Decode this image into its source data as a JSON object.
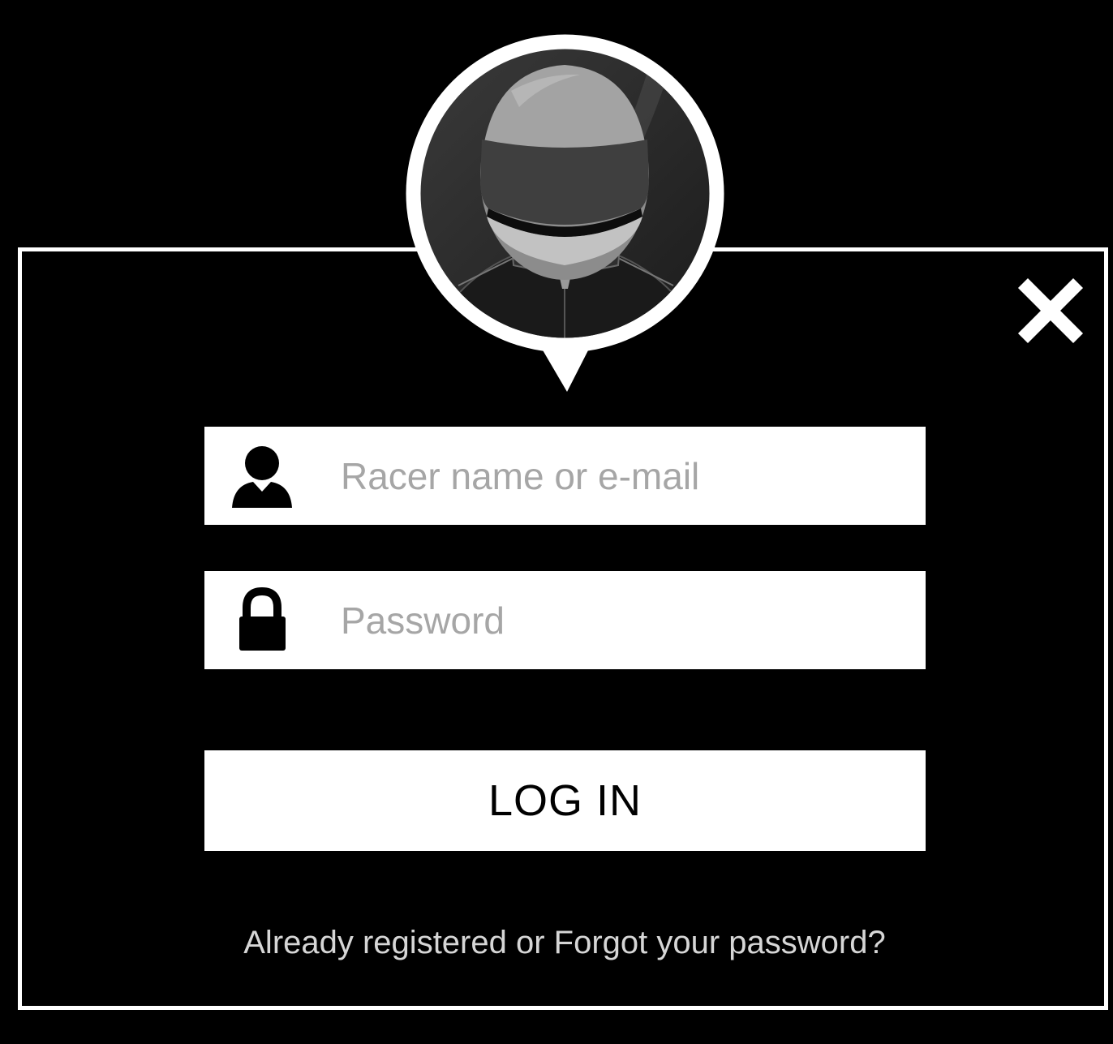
{
  "avatar": {
    "icon": "racer-helmet-icon"
  },
  "close": {
    "icon": "close-icon"
  },
  "login_form": {
    "username": {
      "placeholder": "Racer name or e-mail",
      "value": "",
      "icon": "user-icon"
    },
    "password": {
      "placeholder": "Password",
      "value": "",
      "icon": "lock-icon"
    },
    "submit_label": "LOG IN"
  },
  "footer_links": {
    "registered": "Already registered",
    "separator": " or ",
    "forgot": "Forgot your password?"
  },
  "colors": {
    "background": "#000000",
    "panel_border": "#ffffff",
    "field_background": "#ffffff",
    "placeholder": "#a6a6a6",
    "link": "#d6d6d6"
  }
}
